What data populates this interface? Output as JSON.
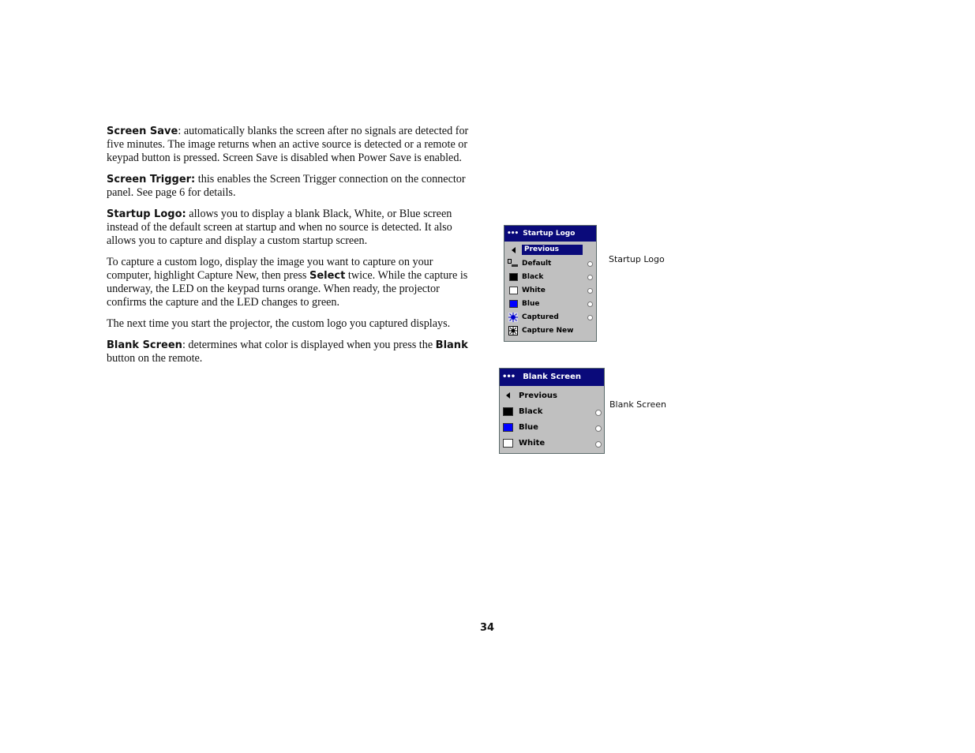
{
  "paragraphs": {
    "screen_save": {
      "term": "Screen Save",
      "text": ": automatically blanks the screen after no signals are detected for five minutes. The image returns when an active source is detected or a remote or keypad button is pressed. Screen Save is disabled when Power Save is enabled."
    },
    "screen_trigger": {
      "term": "Screen Trigger:",
      "text": " this enables the Screen Trigger connection on the connector panel. See page 6 for details."
    },
    "startup_logo": {
      "term": "Startup Logo:",
      "text": " allows you to display a blank Black, White, or Blue screen instead of the default screen at startup and when no source is detected. It also allows you to capture and display a custom startup screen."
    },
    "capture": {
      "before": "To capture a custom logo, display the image you want to capture on your computer, highlight Capture New, then press ",
      "bold": "Select",
      "after": " twice. While the capture is underway, the LED on the keypad turns orange. When ready, the projector confirms the capture and the LED changes to green."
    },
    "next_time": {
      "text": "The next time you start the projector, the custom logo you captured displays."
    },
    "blank_screen": {
      "term": "Blank Screen",
      "text1": ": determines what color is displayed when you press the ",
      "bold": "Blank",
      "text2": " button on the remote."
    }
  },
  "startup_menu": {
    "title": "Startup Logo",
    "dots": "•••",
    "items": [
      {
        "label": "Previous",
        "icon": "arrow-left-icon",
        "highlighted": true
      },
      {
        "label": "Default",
        "icon": "default-logo-icon"
      },
      {
        "label": "Black",
        "icon": "black-swatch-icon"
      },
      {
        "label": "White",
        "icon": "white-swatch-icon"
      },
      {
        "label": "Blue",
        "icon": "blue-swatch-icon"
      },
      {
        "label": "Captured",
        "icon": "captured-icon"
      },
      {
        "label": "Capture New",
        "icon": "capture-new-icon"
      }
    ],
    "caption": "Startup Logo"
  },
  "blank_menu": {
    "title": "Blank Screen",
    "dots": "•••",
    "items": [
      {
        "label": "Previous",
        "icon": "arrow-left-icon"
      },
      {
        "label": "Black",
        "icon": "black-swatch-icon"
      },
      {
        "label": "Blue",
        "icon": "blue-swatch-icon"
      },
      {
        "label": "White",
        "icon": "white-swatch-icon"
      }
    ],
    "caption": "Blank Screen"
  },
  "colors": {
    "menu_title_bg": "#0a0a7a",
    "menu_bg": "#c0c0c0",
    "blue": "#0000ff"
  },
  "page_number": "34"
}
